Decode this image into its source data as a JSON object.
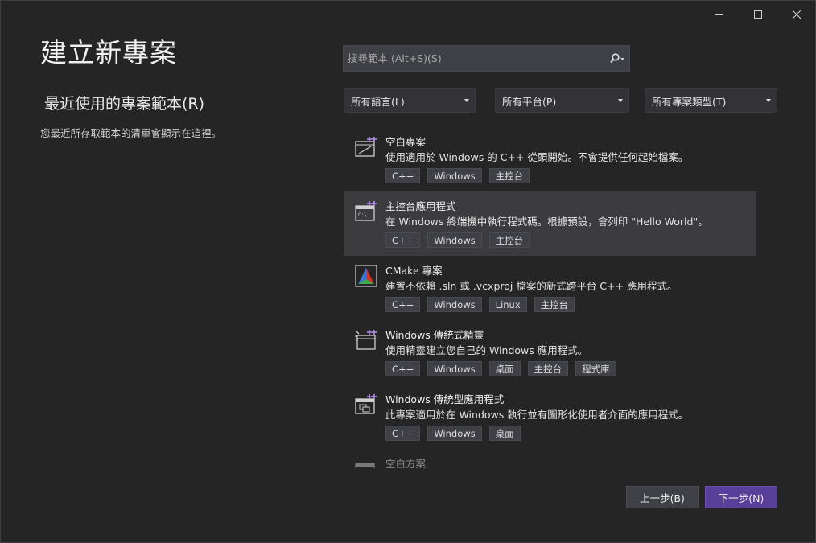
{
  "window": {
    "title": "建立新專案",
    "icons": {
      "minimize": "minimize-icon",
      "maximize": "maximize-icon",
      "close": "close-icon"
    }
  },
  "recent": {
    "title": "最近使用的專案範本(R)",
    "description": "您最近所存取範本的清單會顯示在這裡。"
  },
  "search": {
    "placeholder": "搜尋範本 (Alt+S)(S)",
    "icon": "search-icon"
  },
  "filters": {
    "language": "所有語言(L)",
    "platform": "所有平台(P)",
    "project_type": "所有專案類型(T)"
  },
  "templates": [
    {
      "name": "空白專案",
      "description": "使用適用於 Windows 的 C++ 從頭開始。不會提供任何起始檔案。",
      "tags": [
        "C++",
        "Windows",
        "主控台"
      ],
      "icon": "empty-project-icon",
      "selected": false
    },
    {
      "name": "主控台應用程式",
      "description": "在 Windows 終端機中執行程式碼。根據預設，會列印 \"Hello World\"。",
      "tags": [
        "C++",
        "Windows",
        "主控台"
      ],
      "icon": "console-app-icon",
      "selected": true
    },
    {
      "name": "CMake 專案",
      "description": "建置不依賴 .sln 或 .vcxproj 檔案的新式跨平台 C++ 應用程式。",
      "tags": [
        "C++",
        "Windows",
        "Linux",
        "主控台"
      ],
      "icon": "cmake-icon",
      "selected": false
    },
    {
      "name": "Windows 傳統式精靈",
      "description": "使用精靈建立您自己的 Windows 應用程式。",
      "tags": [
        "C++",
        "Windows",
        "桌面",
        "主控台",
        "程式庫"
      ],
      "icon": "desktop-wizard-icon",
      "selected": false
    },
    {
      "name": "Windows 傳統型應用程式",
      "description": "此專案適用於在 Windows 執行並有圖形化使用者介面的應用程式。",
      "tags": [
        "C++",
        "Windows",
        "桌面"
      ],
      "icon": "desktop-app-icon",
      "selected": false
    },
    {
      "name": "空白方案",
      "description": "",
      "tags": [],
      "icon": "blank-solution-icon",
      "selected": false
    }
  ],
  "buttons": {
    "back": "上一步(B)",
    "next": "下一步(N)"
  },
  "colors": {
    "background": "#252526",
    "selected_row": "#3c3c3f",
    "primary_button": "#5a3f9a",
    "template_sparkle": "#b48ef0"
  }
}
